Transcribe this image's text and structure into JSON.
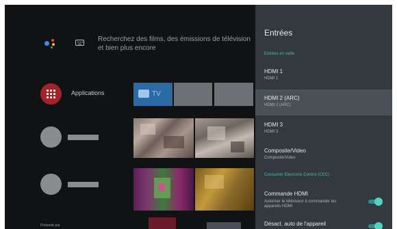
{
  "search": {
    "text": "Recherchez des films, des émissions de télévision et bien plus encore"
  },
  "apps": {
    "label": "Applications"
  },
  "tv_tile": {
    "label": "TV"
  },
  "footer": {
    "text": "Présenté par"
  },
  "panel": {
    "title": "Entrées",
    "section_standby": "Entrées en veille",
    "inputs": [
      {
        "title": "HDMI 1",
        "subtitle": "HDMI 1"
      },
      {
        "title": "HDMI 2 (ARC)",
        "subtitle": "HDMI 2 (ARC)"
      },
      {
        "title": "HDMI 3",
        "subtitle": "HDMI 3"
      },
      {
        "title": "Composite/Video",
        "subtitle": "Composite/Video"
      }
    ],
    "section_cec": "Consumer Electronic Control (CEC)",
    "cec": [
      {
        "title": "Commande HDMI",
        "subtitle": "Autoriser le téléviseur à commander les appareils HDMI",
        "enabled": true
      },
      {
        "title": "Désact. auto de l'appareil",
        "enabled": true
      }
    ]
  },
  "colors": {
    "accent": "#4fb8b0",
    "panel": "#33393e",
    "apps_icon": "#a3232a"
  }
}
